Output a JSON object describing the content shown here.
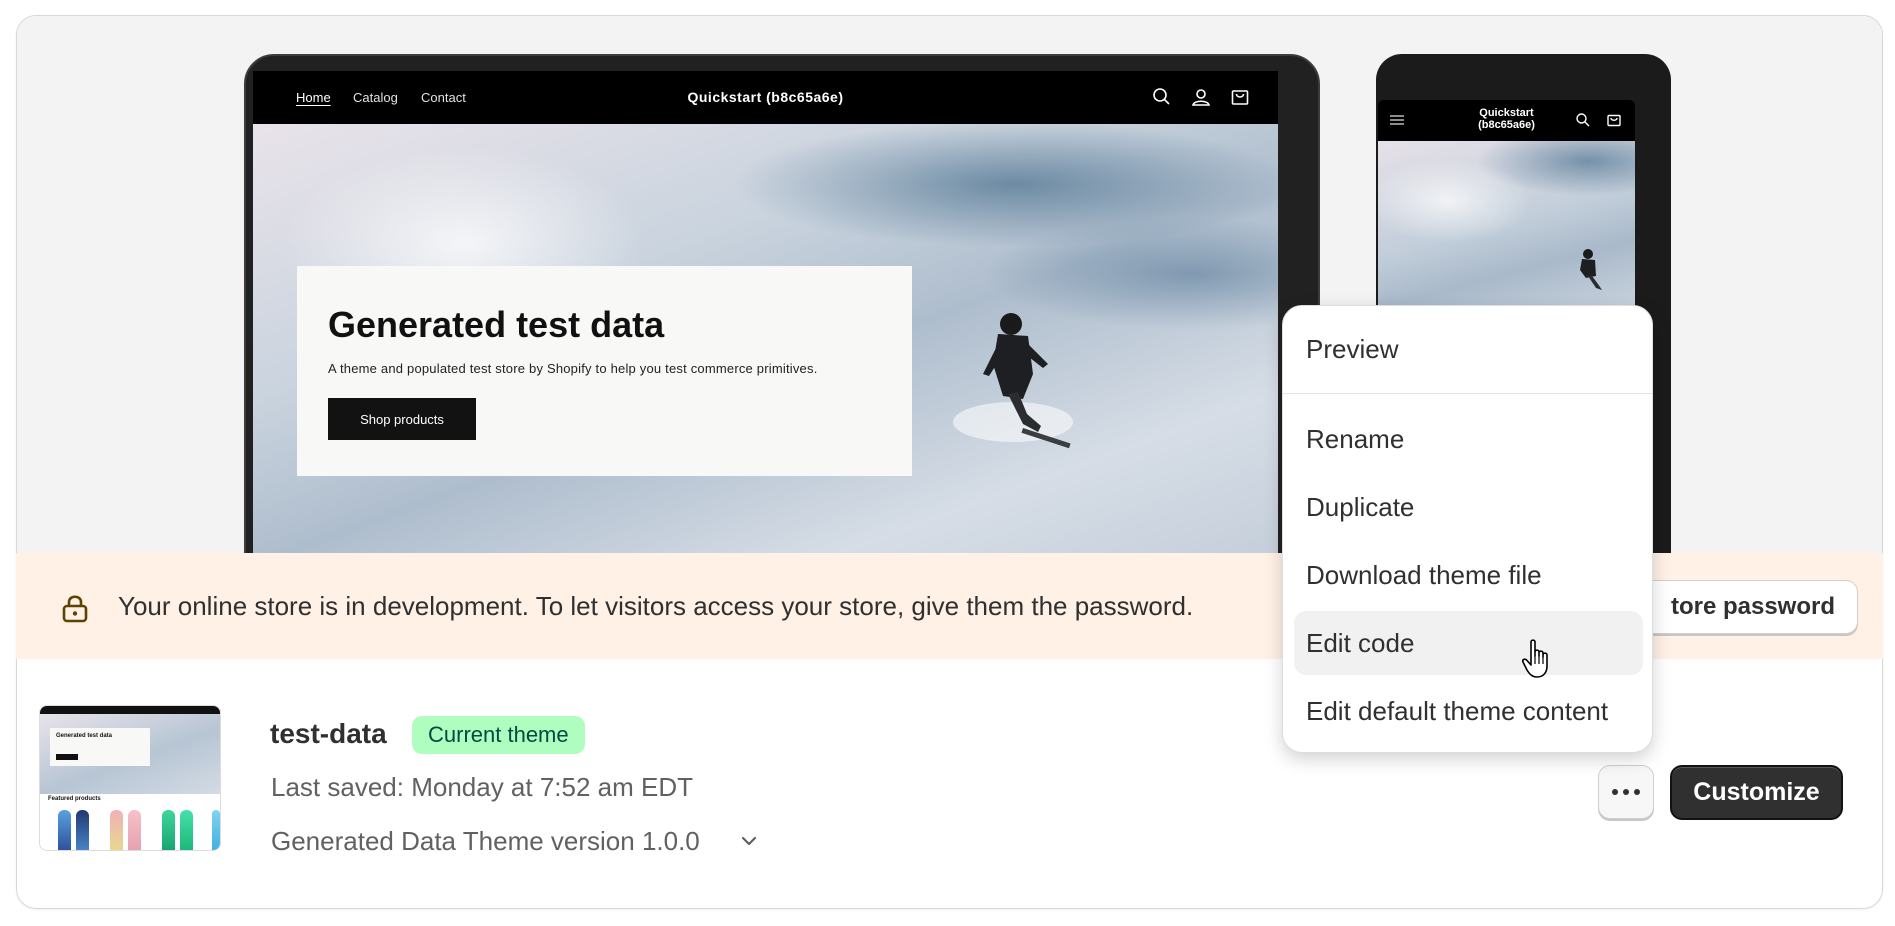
{
  "desktop_preview": {
    "nav": {
      "links": [
        "Home",
        "Catalog",
        "Contact"
      ],
      "store_title": "Quickstart (b8c65a6e)",
      "icons": [
        "search-icon",
        "account-icon",
        "cart-icon"
      ]
    },
    "hero": {
      "title": "Generated test data",
      "subtitle": "A theme and populated test store by Shopify to help you test commerce primitives.",
      "button": "Shop products"
    }
  },
  "mobile_preview": {
    "store_title_line1": "Quickstart",
    "store_title_line2": "(b8c65a6e)",
    "icons": [
      "menu-icon",
      "search-icon",
      "cart-icon"
    ]
  },
  "banner": {
    "text": "Your online store is in development. To let visitors access your store, give them the password.",
    "button": "tore password",
    "background": "#fff1e5"
  },
  "theme": {
    "thumbnail": {
      "hero_title": "Generated test data",
      "featured_label": "Featured products"
    },
    "name": "test-data",
    "badge": "Current theme",
    "last_saved": "Last saved: Monday at 7:52 am EDT",
    "version": "Generated Data Theme version 1.0.0",
    "more_button_icon": "more-horizontal-icon",
    "customize_button": "Customize"
  },
  "dropdown": {
    "items": [
      "Preview",
      "Rename",
      "Duplicate",
      "Download theme file",
      "Edit code",
      "Edit default theme content"
    ],
    "hovered": "Edit code"
  },
  "colors": {
    "badge_bg": "#affebf",
    "badge_text": "#014b40",
    "primary_button": "#303030"
  }
}
